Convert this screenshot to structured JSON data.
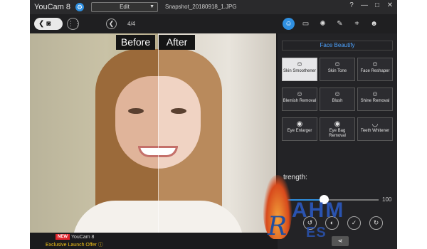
{
  "titlebar": {
    "app_name": "YouCam 8",
    "mode": "Edit",
    "file_name": "Snapshot_20180918_1.JPG",
    "window_buttons": [
      "?",
      "—",
      "□",
      "✕"
    ]
  },
  "toolbar": {
    "page_indicator": "4/4",
    "tool_icons": [
      "face-beautify-icon",
      "frame-icon",
      "effect-icon",
      "brush-icon",
      "crop-icon",
      "masks-icon"
    ]
  },
  "photo": {
    "before_label": "Before",
    "after_label": "After"
  },
  "promo": {
    "badge": "NEW",
    "app": "YouCam 8",
    "offer": "Exclusive Launch Offer ⓘ"
  },
  "panel": {
    "title": "Face Beautify",
    "features": [
      {
        "label": "Skin Smoothener",
        "selected": true
      },
      {
        "label": "Skin Tone",
        "selected": false
      },
      {
        "label": "Face Reshaper",
        "selected": false
      },
      {
        "label": "Blemish Removal",
        "selected": false
      },
      {
        "label": "Blush",
        "selected": false
      },
      {
        "label": "Shine Removal",
        "selected": false
      },
      {
        "label": "Eye Enlarger",
        "selected": false
      },
      {
        "label": "Eye Bag Removal",
        "selected": false
      },
      {
        "label": "Teeth Whitener",
        "selected": false
      }
    ],
    "strength_label": "trength:",
    "slider": {
      "min": "0",
      "max": "100",
      "value": 40
    },
    "accent": "#2f8fe0"
  },
  "watermark": {
    "word": "AHM",
    "sub": "ES"
  }
}
